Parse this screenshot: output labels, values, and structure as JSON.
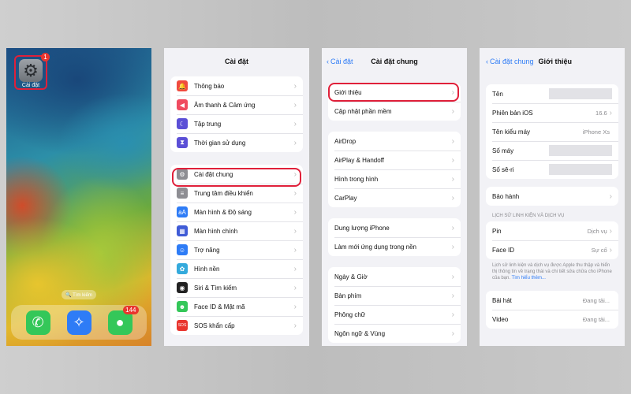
{
  "home": {
    "settings_app_label": "Cài đặt",
    "settings_badge": "1",
    "search_pill": "🔍 Tìm kiếm",
    "messages_badge": "144",
    "dock_icons": [
      "phone-icon",
      "safari-icon",
      "messages-icon"
    ]
  },
  "settings": {
    "title": "Cài đặt",
    "group1": [
      {
        "label": "Thông báo",
        "icon": "bell-icon",
        "color": "#f04b3e"
      },
      {
        "label": "Âm thanh & Cảm ứng",
        "icon": "speaker-icon",
        "color": "#f04b60"
      },
      {
        "label": "Tập trung",
        "icon": "moon-icon",
        "color": "#5b4fd6"
      },
      {
        "label": "Thời gian sử dụng",
        "icon": "hourglass-icon",
        "color": "#5b4fd6"
      }
    ],
    "group2": [
      {
        "label": "Cài đặt chung",
        "icon": "gear-icon",
        "color": "#8e8e93"
      },
      {
        "label": "Trung tâm điều khiển",
        "icon": "switches-icon",
        "color": "#8e8e93"
      },
      {
        "label": "Màn hình & Độ sáng",
        "icon": "aa-icon",
        "color": "#2e7cf6"
      },
      {
        "label": "Màn hình chính",
        "icon": "grid-icon",
        "color": "#3f5bd6"
      },
      {
        "label": "Trợ năng",
        "icon": "accessibility-icon",
        "color": "#2e7cf6"
      },
      {
        "label": "Hình nền",
        "icon": "flower-icon",
        "color": "#34aadc"
      },
      {
        "label": "Siri & Tìm kiếm",
        "icon": "siri-icon",
        "color": "#222"
      },
      {
        "label": "Face ID & Mật mã",
        "icon": "faceid-icon",
        "color": "#34c759"
      },
      {
        "label": "SOS khẩn cấp",
        "icon": "sos-icon",
        "color": "#e9352e"
      }
    ]
  },
  "general": {
    "back": "Cài đặt",
    "title": "Cài đặt chung",
    "group1": [
      "Giới thiệu",
      "Cập nhật phần mềm"
    ],
    "group2": [
      "AirDrop",
      "AirPlay & Handoff",
      "Hình trong hình",
      "CarPlay"
    ],
    "group3": [
      "Dung lượng iPhone",
      "Làm mới ứng dụng trong nền"
    ],
    "group4": [
      "Ngày & Giờ",
      "Bàn phím",
      "Phông chữ",
      "Ngôn ngữ & Vùng"
    ]
  },
  "about": {
    "back": "Cài đặt chung",
    "title": "Giới thiệu",
    "rows": [
      {
        "label": "Tên",
        "value": ""
      },
      {
        "label": "Phiên bản iOS",
        "value": "16.6"
      },
      {
        "label": "Tên kiểu máy",
        "value": "iPhone Xs"
      },
      {
        "label": "Số máy",
        "value": ""
      },
      {
        "label": "Số sê-ri",
        "value": ""
      }
    ],
    "warranty": "Bảo hành",
    "section_header": "LỊCH SỬ LINH KIỆN VÀ DỊCH VỤ",
    "parts": [
      {
        "label": "Pin",
        "value": "Dịch vụ"
      },
      {
        "label": "Face ID",
        "value": "Sự cố"
      }
    ],
    "caption": "Lịch sử linh kiện và dịch vụ được Apple thu thập và hiển thị thông tin về trạng thái và chi tiết sửa chữa cho iPhone của bạn.",
    "caption_link": "Tìm hiểu thêm...",
    "media": [
      {
        "label": "Bài hát",
        "value": "Đang tải..."
      },
      {
        "label": "Video",
        "value": "Đang tải..."
      }
    ]
  }
}
